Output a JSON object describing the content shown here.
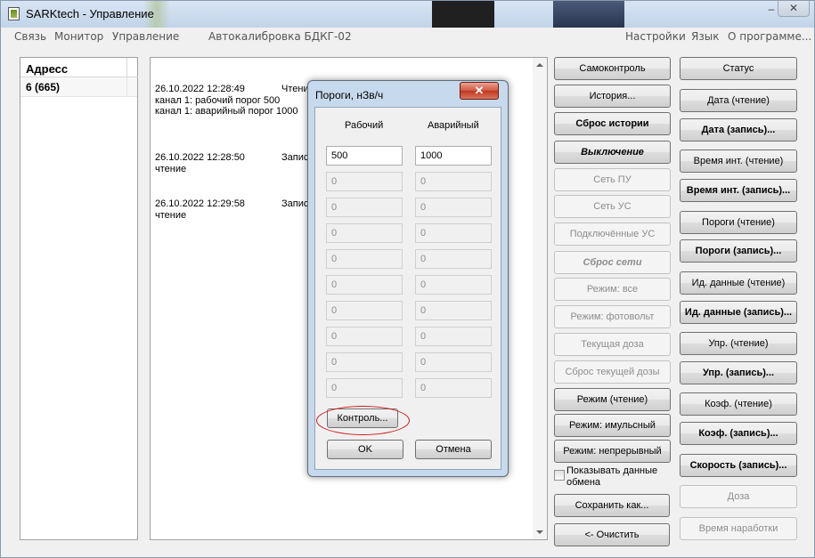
{
  "window": {
    "title": "SARKtech - Управление",
    "minimize_glyph": "–",
    "close_glyph": "✕"
  },
  "menu": {
    "left": [
      "Связь",
      "Монитор",
      "Управление",
      "Автокалибровка БДКГ-02"
    ],
    "right": [
      "Настройки",
      "Язык",
      "О программе..."
    ]
  },
  "address_list": {
    "header": "Адресс",
    "rows": [
      "6 (665)"
    ]
  },
  "log": [
    {
      "time": "26.10.2022 12:28:49",
      "action": "Чтени",
      "lines": [
        "канал 1: рабочий порог 500",
        "канал 1: аварийный порог 1000"
      ]
    },
    {
      "time": "26.10.2022 12:28:50",
      "action": "Запис",
      "lines": [
        "чтение"
      ]
    },
    {
      "time": "26.10.2022 12:29:58",
      "action": "Запис",
      "lines": [
        "чтение"
      ]
    }
  ],
  "middle_buttons": [
    {
      "label": "Самоконтроль",
      "style": "normal"
    },
    {
      "label": "История...",
      "style": "normal"
    },
    {
      "label": "Сброс истории",
      "style": "bold"
    },
    {
      "label": "Выключение",
      "style": "bold-italic"
    },
    {
      "label": "Сеть ПУ",
      "style": "disabled"
    },
    {
      "label": "Сеть УС",
      "style": "disabled"
    },
    {
      "label": "Подключённые УС",
      "style": "disabled"
    },
    {
      "label": "Сброс сети",
      "style": "disabled-bold-italic"
    },
    {
      "label": "Режим: все",
      "style": "disabled"
    },
    {
      "label": "Режим: фотовольт",
      "style": "disabled"
    },
    {
      "label": "Текущая доза",
      "style": "disabled"
    },
    {
      "label": "Сброс текущей дозы",
      "style": "disabled"
    },
    {
      "label": "Режим (чтение)",
      "style": "normal"
    },
    {
      "label": "Режим: имульсный",
      "style": "normal"
    },
    {
      "label": "Режим: непрерывный",
      "style": "normal"
    }
  ],
  "exchange_checkbox": {
    "label_line1": "Показывать данные",
    "label_line2": "обмена",
    "checked": false
  },
  "save_button": "Сохранить как...",
  "clear_button": "<- Очистить",
  "right_buttons": [
    {
      "label": "Статус",
      "style": "normal"
    },
    {
      "label": "Дата (чтение)",
      "style": "normal"
    },
    {
      "label": "Дата (запись)...",
      "style": "bold"
    },
    {
      "label": "Время инт. (чтение)",
      "style": "normal"
    },
    {
      "label": "Время инт. (запись)...",
      "style": "bold"
    },
    {
      "label": "Пороги (чтение)",
      "style": "normal"
    },
    {
      "label": "Пороги (запись)...",
      "style": "bold"
    },
    {
      "label": "Ид. данные (чтение)",
      "style": "normal"
    },
    {
      "label": "Ид. данные (запись)...",
      "style": "bold"
    },
    {
      "label": "Упр. (чтение)",
      "style": "normal"
    },
    {
      "label": "Упр. (запись)...",
      "style": "bold"
    },
    {
      "label": "Коэф. (чтение)",
      "style": "normal"
    },
    {
      "label": "Коэф. (запись)...",
      "style": "bold"
    },
    {
      "label": "Скорость (запись)...",
      "style": "bold"
    },
    {
      "label": "Доза",
      "style": "disabled"
    },
    {
      "label": "Время наработки",
      "style": "disabled"
    }
  ],
  "dialog": {
    "title": "Пороги, нЗв/ч",
    "close_glyph": "✕",
    "col_work": "Рабочий",
    "col_alarm": "Аварийный",
    "rows": [
      {
        "work": "500",
        "alarm": "1000",
        "enabled": true
      },
      {
        "work": "0",
        "alarm": "0",
        "enabled": false
      },
      {
        "work": "0",
        "alarm": "0",
        "enabled": false
      },
      {
        "work": "0",
        "alarm": "0",
        "enabled": false
      },
      {
        "work": "0",
        "alarm": "0",
        "enabled": false
      },
      {
        "work": "0",
        "alarm": "0",
        "enabled": false
      },
      {
        "work": "0",
        "alarm": "0",
        "enabled": false
      },
      {
        "work": "0",
        "alarm": "0",
        "enabled": false
      },
      {
        "work": "0",
        "alarm": "0",
        "enabled": false
      },
      {
        "work": "0",
        "alarm": "0",
        "enabled": false
      }
    ],
    "control_button": "Контроль...",
    "ok_button": "OK",
    "cancel_button": "Отмена"
  },
  "colors": {
    "highlight_circle": "#d01818",
    "dialog_close": "#c3371f"
  }
}
